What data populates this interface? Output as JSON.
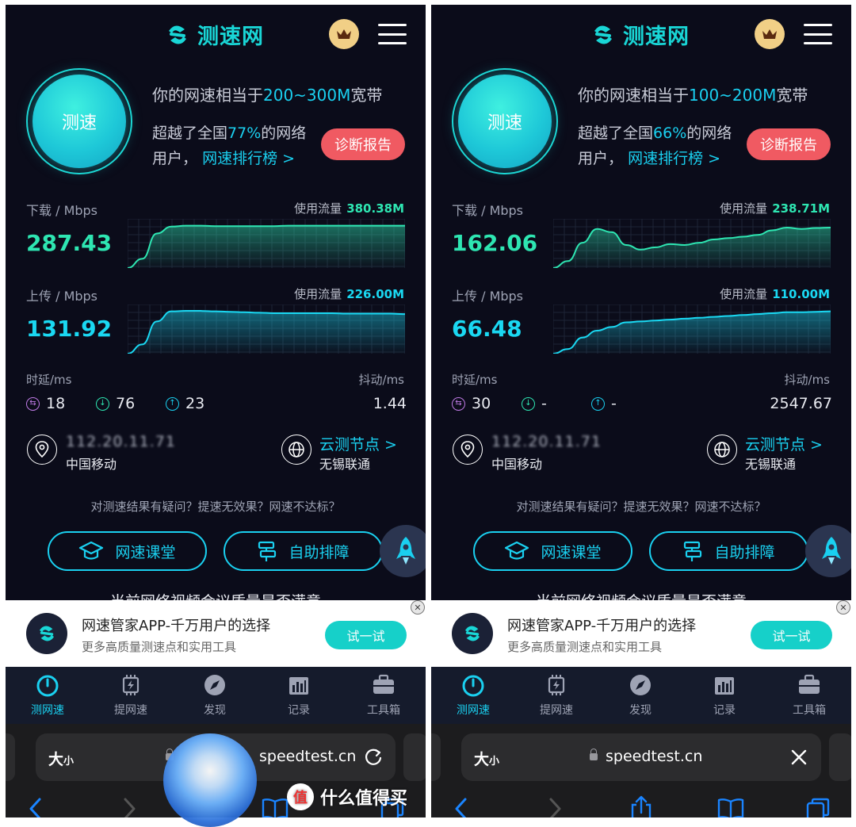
{
  "colors": {
    "accent": "#1ad0f0",
    "download": "#2ee6b2",
    "upload": "#1ad8f2",
    "report": "#f05a62",
    "background": "#0b0c1a"
  },
  "panels": [
    {
      "app": {
        "logo_text": "测速网"
      },
      "result": {
        "headline_prefix": "你的网速相当于",
        "headline_range": "200~300M",
        "headline_suffix": "宽带",
        "surpass_prefix": "超越了全国",
        "surpass_percent": "77%",
        "surpass_suffix": "的网络",
        "surpass_line2": "用户，",
        "rank_link": "网速排行榜 >",
        "speed_button": "测速",
        "report_button": "诊断报告"
      },
      "download": {
        "label": "下载 / Mbps",
        "value": "287.43",
        "usage_label": "使用流量",
        "usage_value": "380.38M"
      },
      "upload": {
        "label": "上传 / Mbps",
        "value": "131.92",
        "usage_label": "使用流量",
        "usage_value": "226.00M"
      },
      "latency": {
        "label": "时延/ms",
        "jitter_label": "抖动/ms",
        "ping": "18",
        "down": "76",
        "up": "23",
        "jitter": "1.44"
      },
      "network": {
        "ip": "112.20.11.71",
        "isp": "中国移动",
        "node_link": "云测节点 >",
        "node_name": "无锡联通"
      },
      "help": {
        "question": "对测速结果有疑问？提速无效果？网速不达标？",
        "course_button": "网速课堂",
        "troubleshoot_button": "自助排障",
        "cut_text": "当前网络视频会议质量是否满意"
      },
      "ad": {
        "title": "网速管家APP-千万用户的选择",
        "subtitle": "更多高质量测速点和实用工具",
        "button": "试一试",
        "close": "✕"
      },
      "tabs": [
        "测网速",
        "提网速",
        "发现",
        "记录",
        "工具箱"
      ],
      "browser": {
        "text_size": "大",
        "text_size_small": "小",
        "url": "speedtest.cn"
      }
    },
    {
      "app": {
        "logo_text": "测速网"
      },
      "result": {
        "headline_prefix": "你的网速相当于",
        "headline_range": "100~200M",
        "headline_suffix": "宽带",
        "surpass_prefix": "超越了全国",
        "surpass_percent": "66%",
        "surpass_suffix": "的网络",
        "surpass_line2": "用户，",
        "rank_link": "网速排行榜 >",
        "speed_button": "测速",
        "report_button": "诊断报告"
      },
      "download": {
        "label": "下载 / Mbps",
        "value": "162.06",
        "usage_label": "使用流量",
        "usage_value": "238.71M"
      },
      "upload": {
        "label": "上传 / Mbps",
        "value": "66.48",
        "usage_label": "使用流量",
        "usage_value": "110.00M"
      },
      "latency": {
        "label": "时延/ms",
        "jitter_label": "抖动/ms",
        "ping": "30",
        "down": "-",
        "up": "-",
        "jitter": "2547.67"
      },
      "network": {
        "ip": "112.20.11.71",
        "isp": "中国移动",
        "node_link": "云测节点 >",
        "node_name": "无锡联通"
      },
      "help": {
        "question": "对测速结果有疑问？提速无效果？网速不达标？",
        "course_button": "网速课堂",
        "troubleshoot_button": "自助排障",
        "cut_text": "当前网络视频会议质量是否满意"
      },
      "ad": {
        "title": "网速管家APP-千万用户的选择",
        "subtitle": "更多高质量测速点和实用工具",
        "button": "试一试",
        "close": "✕"
      },
      "tabs": [
        "测网速",
        "提网速",
        "发现",
        "记录",
        "工具箱"
      ],
      "browser": {
        "text_size": "大",
        "text_size_small": "小",
        "url": "speedtest.cn"
      }
    }
  ],
  "watermark": {
    "icon_text": "值",
    "text": "什么值得买"
  },
  "chart_data": [
    {
      "type": "area",
      "title": "",
      "series": [
        {
          "name": "",
          "values": [
            0,
            0.2,
            0.75,
            0.9,
            0.92,
            0.92,
            0.91,
            0.91,
            0.91,
            0.91,
            0.91,
            0.92,
            0.92,
            0.92,
            0.92,
            0.92,
            0.92,
            0.92,
            0.92,
            0.92
          ]
        }
      ],
      "ylim": [
        0,
        1
      ]
    },
    {
      "type": "area",
      "title": "",
      "series": [
        {
          "name": "",
          "values": [
            0,
            0.2,
            0.7,
            0.92,
            0.93,
            0.93,
            0.92,
            0.91,
            0.9,
            0.89,
            0.88,
            0.88,
            0.88,
            0.88,
            0.88,
            0.87,
            0.87,
            0.87,
            0.87,
            0.86
          ]
        }
      ],
      "ylim": [
        0,
        1
      ]
    },
    {
      "type": "area",
      "title": "",
      "series": [
        {
          "name": "",
          "values": [
            0,
            0.15,
            0.55,
            0.85,
            0.78,
            0.5,
            0.4,
            0.45,
            0.52,
            0.5,
            0.55,
            0.62,
            0.65,
            0.68,
            0.72,
            0.82,
            0.88,
            0.85,
            0.87,
            0.88
          ]
        }
      ],
      "ylim": [
        0,
        1
      ]
    },
    {
      "type": "area",
      "title": "",
      "series": [
        {
          "name": "",
          "values": [
            0,
            0.1,
            0.35,
            0.5,
            0.58,
            0.68,
            0.7,
            0.72,
            0.74,
            0.76,
            0.78,
            0.8,
            0.82,
            0.84,
            0.86,
            0.88,
            0.9,
            0.9,
            0.91,
            0.92
          ]
        }
      ],
      "ylim": [
        0,
        1
      ]
    }
  ]
}
